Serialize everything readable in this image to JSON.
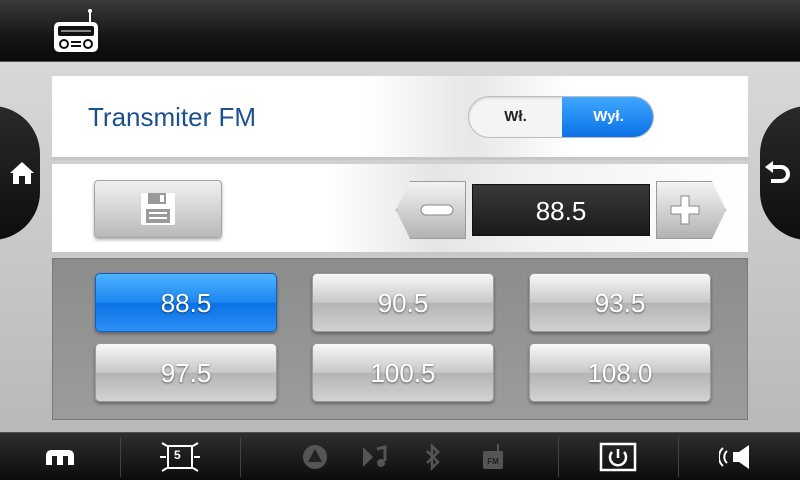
{
  "header": {
    "icon": "radio-icon"
  },
  "nav": {
    "home_icon": "home-icon",
    "back_icon": "back-arrow-icon"
  },
  "transmitter": {
    "title": "Transmiter FM",
    "toggle": {
      "on_label": "Wł.",
      "off_label": "Wył.",
      "selected": "off"
    }
  },
  "tuner": {
    "save_icon": "floppy-disk-icon",
    "frequency": "88.5",
    "decrement_icon": "minus-icon",
    "increment_icon": "plus-icon"
  },
  "presets": [
    {
      "label": "88.5",
      "active": true
    },
    {
      "label": "90.5",
      "active": false
    },
    {
      "label": "93.5",
      "active": false
    },
    {
      "label": "97.5",
      "active": false
    },
    {
      "label": "100.5",
      "active": false
    },
    {
      "label": "108.0",
      "active": false
    }
  ],
  "bottom_bar": {
    "menu_icon": "menu-icon",
    "screen_badge": "5",
    "status_icons": [
      "navigation-icon",
      "music-icon",
      "bluetooth-icon",
      "fm-icon"
    ],
    "fm_label": "FM",
    "power_icon": "power-icon",
    "volume_icon": "speaker-icon"
  },
  "colors": {
    "accent": "#0a72e6",
    "title": "#1b4f8f"
  }
}
